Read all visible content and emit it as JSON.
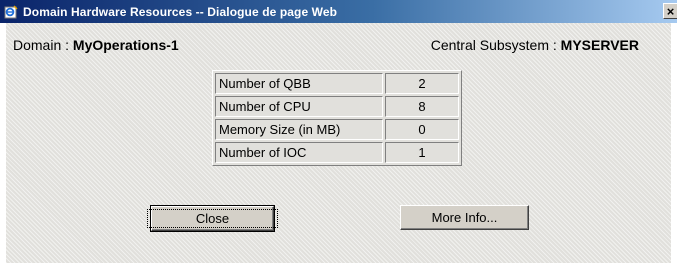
{
  "window": {
    "title": "Domain Hardware Resources -- Dialogue de page Web",
    "close_glyph": "×"
  },
  "header": {
    "domain_label": "Domain : ",
    "domain_value": "MyOperations-1",
    "subsystem_label": "Central Subsystem : ",
    "subsystem_value": "MYSERVER"
  },
  "resources": [
    {
      "label": "Number of QBB",
      "value": "2"
    },
    {
      "label": "Number of CPU",
      "value": "8"
    },
    {
      "label": "Memory Size (in MB)",
      "value": "0"
    },
    {
      "label": "Number of IOC",
      "value": "1"
    }
  ],
  "buttons": {
    "close_label": "Close",
    "more_info_label": "More Info..."
  },
  "icons": {
    "title_icon": "ie-page-icon"
  },
  "colors": {
    "titlebar_start": "#0a246a",
    "titlebar_end": "#a6caf0",
    "dialog_bg": "#e1e0dc"
  }
}
